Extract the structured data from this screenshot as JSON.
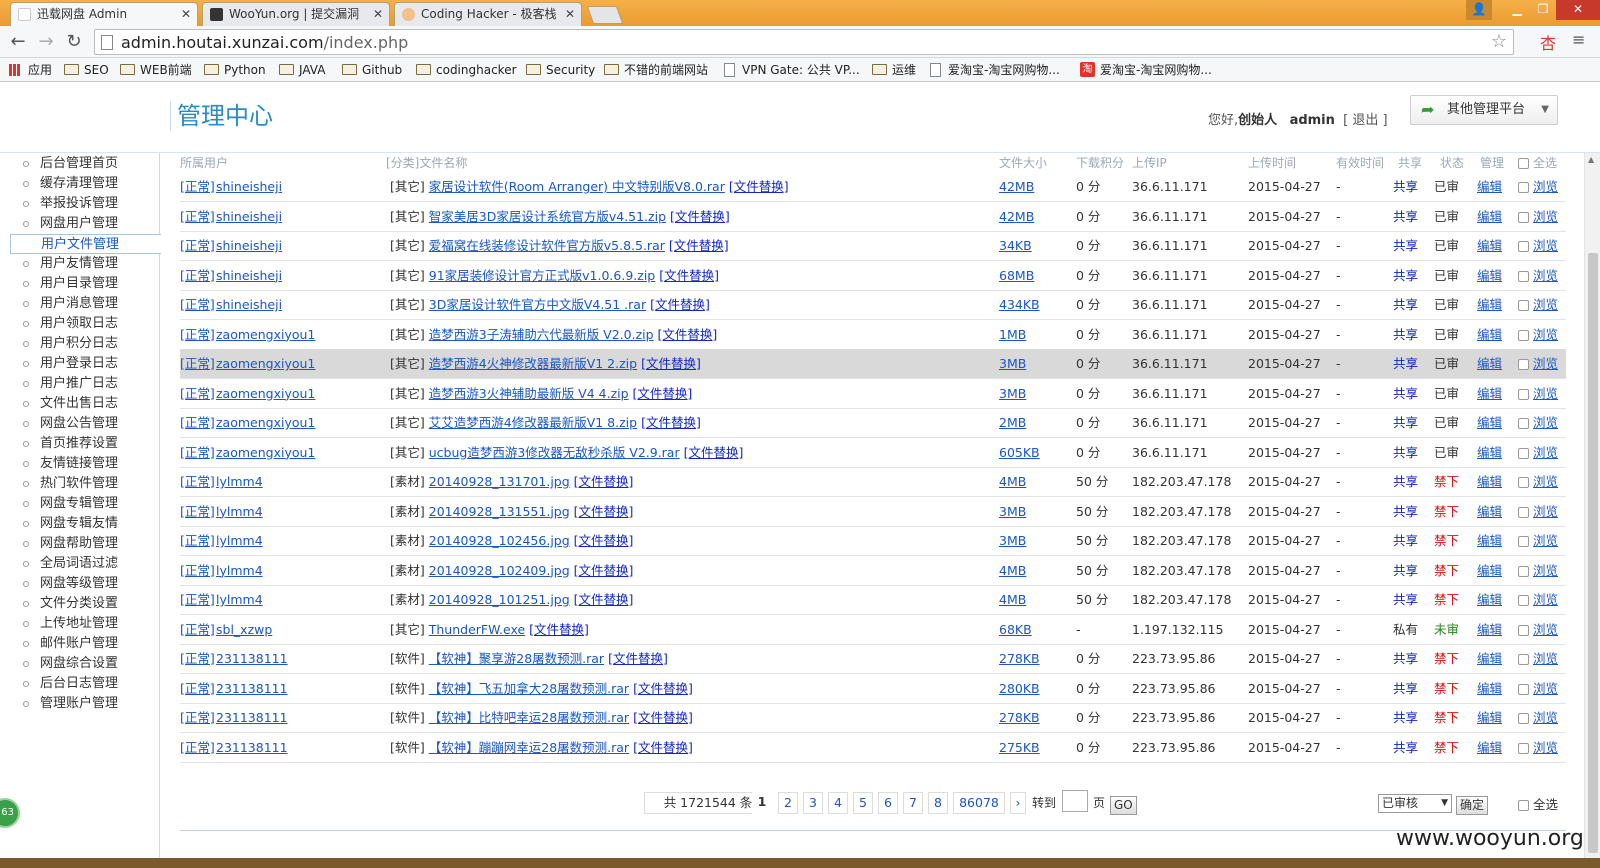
{
  "browser": {
    "tabs": [
      {
        "title": "迅载网盘 Admin",
        "active": true
      },
      {
        "title": "WooYun.org | 提交漏洞",
        "active": false
      },
      {
        "title": "Coding Hacker - 极客栈",
        "active": false
      }
    ],
    "url_host": "admin.houtai.xunzai.com",
    "url_path": "/index.php",
    "bookmarks": [
      "应用",
      "SEO",
      "WEB前端",
      "Python",
      "JAVA",
      "Github",
      "codinghacker",
      "Security",
      "不错的前端网站",
      "VPN Gate: 公共 VP...",
      "运维",
      "爱淘宝-淘宝网购物...",
      "爱淘宝-淘宝网购物..."
    ]
  },
  "header": {
    "title": "管理中心",
    "greeting": "您好,",
    "role": "创始人",
    "user": "admin",
    "logout": "[ 退出 ]",
    "other_platform": "其他管理平台"
  },
  "sidebar": {
    "items": [
      "后台管理首页",
      "缓存清理管理",
      "举报投诉管理",
      "网盘用户管理",
      "用户文件管理",
      "用户友情管理",
      "用户目录管理",
      "用户消息管理",
      "用户领取日志",
      "用户积分日志",
      "用户登录日志",
      "用户推广日志",
      "文件出售日志",
      "网盘公告管理",
      "首页推荐设置",
      "友情链接管理",
      "热门软件管理",
      "网盘专辑管理",
      "网盘专辑友情",
      "网盘帮助管理",
      "全局词语过滤",
      "网盘等级管理",
      "文件分类设置",
      "上传地址管理",
      "邮件账户管理",
      "网盘综合设置",
      "后台日志管理",
      "管理账户管理"
    ],
    "active_index": 4,
    "badge": "63"
  },
  "table": {
    "headers": {
      "user": "所属用户",
      "file": "[分类]文件名称",
      "size": "文件大小",
      "points": "下载积分",
      "ip": "上传IP",
      "time": "上传时间",
      "valid": "有效时间",
      "share": "共享",
      "status": "状态",
      "manage": "管理",
      "selectall": "全选"
    },
    "rows": [
      {
        "tag": "[正常]",
        "user": "shineisheji",
        "cat": "[其它]",
        "file": "家居设计软件(Room Arranger) 中文特别版V8.0.rar",
        "replace": "[文件替换]",
        "size": "42MB",
        "points": "0 分",
        "ip": "36.6.11.171",
        "time": "2015-04-27",
        "valid": "-",
        "share": "共享",
        "status": "已审",
        "edit": "编辑",
        "view": "浏览"
      },
      {
        "tag": "[正常]",
        "user": "shineisheji",
        "cat": "[其它]",
        "file": "智家美居3D家居设计系统官方版v4.51.zip",
        "replace": "[文件替换]",
        "size": "42MB",
        "points": "0 分",
        "ip": "36.6.11.171",
        "time": "2015-04-27",
        "valid": "-",
        "share": "共享",
        "status": "已审",
        "edit": "编辑",
        "view": "浏览"
      },
      {
        "tag": "[正常]",
        "user": "shineisheji",
        "cat": "[其它]",
        "file": "爱福窝在线装修设计软件官方版v5.8.5.rar",
        "replace": "[文件替换]",
        "size": "34KB",
        "points": "0 分",
        "ip": "36.6.11.171",
        "time": "2015-04-27",
        "valid": "-",
        "share": "共享",
        "status": "已审",
        "edit": "编辑",
        "view": "浏览"
      },
      {
        "tag": "[正常]",
        "user": "shineisheji",
        "cat": "[其它]",
        "file": "91家居装修设计官方正式版v1.0.6.9.zip",
        "replace": "[文件替换]",
        "size": "68MB",
        "points": "0 分",
        "ip": "36.6.11.171",
        "time": "2015-04-27",
        "valid": "-",
        "share": "共享",
        "status": "已审",
        "edit": "编辑",
        "view": "浏览"
      },
      {
        "tag": "[正常]",
        "user": "shineisheji",
        "cat": "[其它]",
        "file": "3D家居设计软件官方中文版V4.51 .rar",
        "replace": "[文件替换]",
        "size": "434KB",
        "points": "0 分",
        "ip": "36.6.11.171",
        "time": "2015-04-27",
        "valid": "-",
        "share": "共享",
        "status": "已审",
        "edit": "编辑",
        "view": "浏览"
      },
      {
        "tag": "[正常]",
        "user": "zaomengxiyou1",
        "cat": "[其它]",
        "file": "造梦西游3子涛辅助六代最新版 V2.0.zip",
        "replace": "[文件替换]",
        "size": "1MB",
        "points": "0 分",
        "ip": "36.6.11.171",
        "time": "2015-04-27",
        "valid": "-",
        "share": "共享",
        "status": "已审",
        "edit": "编辑",
        "view": "浏览"
      },
      {
        "tag": "[正常]",
        "user": "zaomengxiyou1",
        "cat": "[其它]",
        "file": "造梦西游4火神修改器最新版V1 2.zip",
        "replace": "[文件替换]",
        "size": "3MB",
        "points": "0 分",
        "ip": "36.6.11.171",
        "time": "2015-04-27",
        "valid": "-",
        "share": "共享",
        "status": "已审",
        "edit": "编辑",
        "view": "浏览",
        "highlight": true
      },
      {
        "tag": "[正常]",
        "user": "zaomengxiyou1",
        "cat": "[其它]",
        "file": "造梦西游3火神辅助最新版 V4 4.zip",
        "replace": "[文件替换]",
        "size": "3MB",
        "points": "0 分",
        "ip": "36.6.11.171",
        "time": "2015-04-27",
        "valid": "-",
        "share": "共享",
        "status": "已审",
        "edit": "编辑",
        "view": "浏览"
      },
      {
        "tag": "[正常]",
        "user": "zaomengxiyou1",
        "cat": "[其它]",
        "file": "艾艾造梦西游4修改器最新版V1 8.zip",
        "replace": "[文件替换]",
        "size": "2MB",
        "points": "0 分",
        "ip": "36.6.11.171",
        "time": "2015-04-27",
        "valid": "-",
        "share": "共享",
        "status": "已审",
        "edit": "编辑",
        "view": "浏览"
      },
      {
        "tag": "[正常]",
        "user": "zaomengxiyou1",
        "cat": "[其它]",
        "file": "ucbug造梦西游3修改器无敌秒杀版 V2.9.rar",
        "replace": "[文件替换]",
        "size": "605KB",
        "points": "0 分",
        "ip": "36.6.11.171",
        "time": "2015-04-27",
        "valid": "-",
        "share": "共享",
        "status": "已审",
        "edit": "编辑",
        "view": "浏览"
      },
      {
        "tag": "[正常]",
        "user": "lylmm4",
        "cat": "[素材]",
        "file": "20140928_131701.jpg",
        "replace": "[文件替换]",
        "size": "4MB",
        "points": "50 分",
        "ip": "182.203.47.178",
        "time": "2015-04-27",
        "valid": "-",
        "share": "共享",
        "status": "禁下",
        "edit": "编辑",
        "view": "浏览"
      },
      {
        "tag": "[正常]",
        "user": "lylmm4",
        "cat": "[素材]",
        "file": "20140928_131551.jpg",
        "replace": "[文件替换]",
        "size": "3MB",
        "points": "50 分",
        "ip": "182.203.47.178",
        "time": "2015-04-27",
        "valid": "-",
        "share": "共享",
        "status": "禁下",
        "edit": "编辑",
        "view": "浏览"
      },
      {
        "tag": "[正常]",
        "user": "lylmm4",
        "cat": "[素材]",
        "file": "20140928_102456.jpg",
        "replace": "[文件替换]",
        "size": "3MB",
        "points": "50 分",
        "ip": "182.203.47.178",
        "time": "2015-04-27",
        "valid": "-",
        "share": "共享",
        "status": "禁下",
        "edit": "编辑",
        "view": "浏览"
      },
      {
        "tag": "[正常]",
        "user": "lylmm4",
        "cat": "[素材]",
        "file": "20140928_102409.jpg",
        "replace": "[文件替换]",
        "size": "4MB",
        "points": "50 分",
        "ip": "182.203.47.178",
        "time": "2015-04-27",
        "valid": "-",
        "share": "共享",
        "status": "禁下",
        "edit": "编辑",
        "view": "浏览"
      },
      {
        "tag": "[正常]",
        "user": "lylmm4",
        "cat": "[素材]",
        "file": "20140928_101251.jpg",
        "replace": "[文件替换]",
        "size": "4MB",
        "points": "50 分",
        "ip": "182.203.47.178",
        "time": "2015-04-27",
        "valid": "-",
        "share": "共享",
        "status": "禁下",
        "edit": "编辑",
        "view": "浏览"
      },
      {
        "tag": "[正常]",
        "user": "sbl_xzwp",
        "cat": "[其它]",
        "file": "ThunderFW.exe",
        "replace": "[文件替换]",
        "size": "68KB",
        "points": "-",
        "ip": "1.197.132.115",
        "time": "2015-04-27",
        "valid": "-",
        "share": "私有",
        "status": "未审",
        "edit": "编辑",
        "view": "浏览"
      },
      {
        "tag": "[正常]",
        "user": "231138111",
        "cat": "[软件]",
        "file": "【软神】聚享游28屠数预测.rar",
        "replace": "[文件替换]",
        "size": "278KB",
        "points": "0 分",
        "ip": "223.73.95.86",
        "time": "2015-04-27",
        "valid": "-",
        "share": "共享",
        "status": "禁下",
        "edit": "编辑",
        "view": "浏览"
      },
      {
        "tag": "[正常]",
        "user": "231138111",
        "cat": "[软件]",
        "file": "【软神】飞五加拿大28屠数预测.rar",
        "replace": "[文件替换]",
        "size": "280KB",
        "points": "0 分",
        "ip": "223.73.95.86",
        "time": "2015-04-27",
        "valid": "-",
        "share": "共享",
        "status": "禁下",
        "edit": "编辑",
        "view": "浏览"
      },
      {
        "tag": "[正常]",
        "user": "231138111",
        "cat": "[软件]",
        "file": "【软神】比特吧幸运28屠数预测.rar",
        "replace": "[文件替换]",
        "size": "278KB",
        "points": "0 分",
        "ip": "223.73.95.86",
        "time": "2015-04-27",
        "valid": "-",
        "share": "共享",
        "status": "禁下",
        "edit": "编辑",
        "view": "浏览"
      },
      {
        "tag": "[正常]",
        "user": "231138111",
        "cat": "[软件]",
        "file": "【软神】蹦蹦网幸运28屠数预测.rar",
        "replace": "[文件替换]",
        "size": "275KB",
        "points": "0 分",
        "ip": "223.73.95.86",
        "time": "2015-04-27",
        "valid": "-",
        "share": "共享",
        "status": "禁下",
        "edit": "编辑",
        "view": "浏览"
      }
    ]
  },
  "pager": {
    "total": "共 1721544 条",
    "pages": [
      "1",
      "2",
      "3",
      "4",
      "5",
      "6",
      "7",
      "8",
      "86078"
    ],
    "next": "›",
    "goto": "转到",
    "page_unit": "页",
    "go": "GO",
    "select_value": "已审核",
    "confirm": "确定",
    "select_all": "全选"
  },
  "watermark": "www.wooyun.org",
  "colors": {
    "accent": "#2a8bc8",
    "link": "#1a56c9",
    "ban": "#e01010",
    "pending": "#1d8a1d",
    "tabbar": "#ec9a2e"
  }
}
